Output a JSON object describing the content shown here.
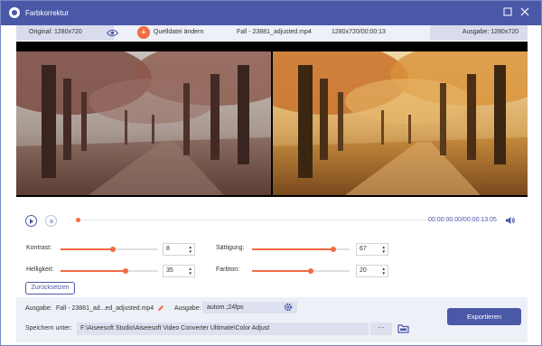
{
  "window": {
    "title": "Farbkorrektur",
    "minimize_icon": "minimize-icon",
    "close_icon": "close-icon"
  },
  "infobar": {
    "original_label": "Original: 1280x720",
    "add_source_label": "Quelldatei ändern",
    "file_name": "Fall - 23881_adjusted.mp4",
    "file_meta": "1280x720/00:00:13",
    "output_label": "Ausgabe: 1280x720"
  },
  "player": {
    "timecode": "00:00:00.00/00:00:13.05",
    "progress": 0.0
  },
  "adjust": {
    "contrast": {
      "label": "Kontrast:",
      "value": "8",
      "level": 0.54
    },
    "saturation": {
      "label": "Sättigung:",
      "value": "67",
      "level": 0.83
    },
    "brightness": {
      "label": "Helligkeit:",
      "value": "35",
      "level": 0.67
    },
    "hue": {
      "label": "Farbton:",
      "value": "20",
      "level": 0.6
    },
    "reset_label": "Zurücksetzen"
  },
  "bottom": {
    "output_label": "Ausgabe:",
    "output_file": "Fall - 23881_ad...ed_adjusted.mp4",
    "format_label": "Ausgabe:",
    "format_value": "autom.;24fps",
    "save_label": "Speichern unter:",
    "save_path": "F:\\Aiseesoft Studio\\Aiseesoft Video Converter Ultimate\\Color Adjust",
    "dots_label": "···",
    "export_label": "Exportieren"
  },
  "colors": {
    "accent": "#4a58a8",
    "orange": "#f26b43"
  }
}
